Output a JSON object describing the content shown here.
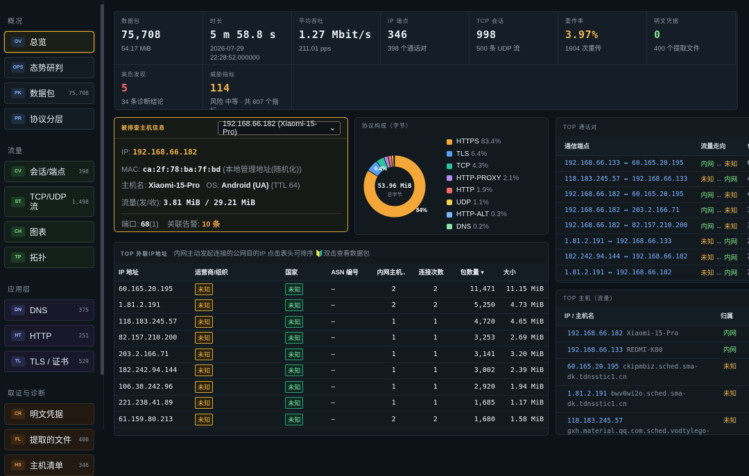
{
  "sidebar": {
    "sections": [
      {
        "title": "概况",
        "items": [
          {
            "badge": "OV",
            "label": "总览",
            "count": ""
          },
          {
            "badge": "OPS",
            "label": "态势研判",
            "count": ""
          },
          {
            "badge": "PK",
            "label": "数据包",
            "count": "75,708"
          },
          {
            "badge": "PR",
            "label": "协议分层",
            "count": ""
          }
        ]
      },
      {
        "title": "流量",
        "items": [
          {
            "badge": "CV",
            "label": "会话/端点",
            "count": "398"
          },
          {
            "badge": "ST",
            "label": "TCP/UDP 流",
            "count": "1,498"
          },
          {
            "badge": "CH",
            "label": "图表",
            "count": ""
          },
          {
            "badge": "TP",
            "label": "拓扑",
            "count": ""
          }
        ]
      },
      {
        "title": "应用层",
        "items": [
          {
            "badge": "DN",
            "label": "DNS",
            "count": "375"
          },
          {
            "badge": "HT",
            "label": "HTTP",
            "count": "251"
          },
          {
            "badge": "TL",
            "label": "TLS / 证书",
            "count": "529"
          }
        ]
      },
      {
        "title": "取证与诊断",
        "items": [
          {
            "badge": "CR",
            "label": "明文凭据",
            "count": ""
          },
          {
            "badge": "FL",
            "label": "提取的文件",
            "count": "400"
          },
          {
            "badge": "HS",
            "label": "主机清单",
            "count": "346"
          }
        ]
      }
    ]
  },
  "stats": [
    {
      "label": "数据包",
      "value": "75,708",
      "sub": "54.17 MiB",
      "color": "#e6edf3"
    },
    {
      "label": "时长",
      "value": "5 m 58.8 s",
      "sub": "2026-07-29 22:28:52.000000",
      "color": "#e6edf3"
    },
    {
      "label": "平均吞吐",
      "value": "1.27 Mbit/s",
      "sub": "211.01 pps",
      "color": "#e6edf3"
    },
    {
      "label": "IP 端点",
      "value": "346",
      "sub": "398 个通话对",
      "color": "#e6edf3"
    },
    {
      "label": "TCP 会话",
      "value": "998",
      "sub": "500 条 UDP 流",
      "color": "#e6edf3"
    },
    {
      "label": "重传率",
      "value": "3.97%",
      "sub": "1604 次重传",
      "color": "#f0b44c"
    },
    {
      "label": "明文凭据",
      "value": "0",
      "sub": "400 个提取文件",
      "color": "#7ee787"
    },
    {
      "label": "高危发现",
      "value": "5",
      "sub": "34 条诊断结论",
      "color": "#ff6b6b"
    },
    {
      "label": "威胁指标",
      "value": "114",
      "sub": "风险 中等 · 共 607 个指标",
      "color": "#f0b44c"
    }
  ],
  "host": {
    "title": "被排查主机信息",
    "selected": "192.168.66.182 (Xiaomi-15-Pro)",
    "ip_label": "IP:",
    "ip": "192.168.66.182",
    "mac_label": "MAC:",
    "mac": "ca:2f:78:ba:7f:bd",
    "mac_note": "(本地管理地址(随机化))",
    "hostname_label": "主机名:",
    "hostname": "Xiaomi-15-Pro",
    "os_label": "OS:",
    "os": "Android (UA)",
    "os_note": "(TTL 64)",
    "traffic_label": "流量(发/收):",
    "traffic": "3.81 MiB / 29.21 MiB",
    "ports_label": "端口:",
    "ports": "68",
    "ports_note": "(1)",
    "alerts_label": "关联告警:",
    "alerts": "10 条"
  },
  "protocol": {
    "title": "协议构成（字节）",
    "center_value": "53.96 MiB",
    "center_label": "总字节",
    "label_big": "84%",
    "label_small": "6.4%",
    "items": [
      {
        "name": "HTTPS",
        "pct": "83.4%",
        "value": 83.4,
        "color": "#f5a83a"
      },
      {
        "name": "TLS",
        "pct": "6.4%",
        "value": 6.4,
        "color": "#5aa0f2"
      },
      {
        "name": "TCP",
        "pct": "4.3%",
        "value": 4.3,
        "color": "#2ec4a0"
      },
      {
        "name": "HTTP-PROXY",
        "pct": "2.1%",
        "value": 2.1,
        "color": "#b58cf2"
      },
      {
        "name": "HTTP",
        "pct": "1.9%",
        "value": 1.9,
        "color": "#f26b6b"
      },
      {
        "name": "UDP",
        "pct": "1.1%",
        "value": 1.1,
        "color": "#f2d04a"
      },
      {
        "name": "HTTP-ALT",
        "pct": "0.3%",
        "value": 0.3,
        "color": "#7ab8f5"
      },
      {
        "name": "DNS",
        "pct": "0.2%",
        "value": 0.2,
        "color": "#8ee0b0"
      }
    ]
  },
  "conversations": {
    "title": "TOP 通话对",
    "headers": [
      "通信端点",
      "流量走向",
      "包"
    ],
    "rows": [
      {
        "ep": "192.168.66.133 ↔ 60.165.20.195",
        "from": "内网",
        "to": "未知",
        "n": "6,"
      },
      {
        "ep": "118.183.245.57 ↔ 192.168.66.133",
        "from": "未知",
        "to": "内网",
        "n": "4,"
      },
      {
        "ep": "192.168.66.182 ↔ 60.165.20.195",
        "from": "内网",
        "to": "未知",
        "n": "4,"
      },
      {
        "ep": "192.168.66.182 ↔ 203.2.166.71",
        "from": "内网",
        "to": "未知",
        "n": "3,"
      },
      {
        "ep": "192.168.66.182 ↔ 82.157.210.200",
        "from": "内网",
        "to": "未知",
        "n": "3,"
      },
      {
        "ep": "1.81.2.191 ↔ 192.168.66.133",
        "from": "未知",
        "to": "内网",
        "n": "2,"
      },
      {
        "ep": "182.242.94.144 ↔ 192.168.66.182",
        "from": "未知",
        "to": "内网",
        "n": "2,"
      },
      {
        "ep": "1.81.2.191 ↔ 192.168.66.182",
        "from": "未知",
        "to": "内网",
        "n": "2,"
      }
    ]
  },
  "hosts": {
    "title": "TOP 主机（流量）",
    "headers": [
      "IP / 主机名",
      "归属"
    ],
    "rows": [
      {
        "ip": "192.168.66.182",
        "name": "Xiaomi-15-Pro",
        "own": "内网"
      },
      {
        "ip": "192.168.66.133",
        "name": "REDMI-K80",
        "own": "内网"
      },
      {
        "ip": "60.165.20.195",
        "name": "ckipmbiz.sched.sma-dk.tdnsstic1.cn",
        "own": "未知"
      },
      {
        "ip": "1.81.2.191",
        "name": "bwv0wi2o.sched.sma-dk.tdnsstic1.cn",
        "own": "未知"
      },
      {
        "ip": "118.183.245.57",
        "name": "gxh.material.qq.com.sched.vodtylego-",
        "own": "未知"
      }
    ]
  },
  "external": {
    "title": "TOP 外联IP地址",
    "desc": "内网主动发起连接的公网目的IP 点击表头可排序 ",
    "hint": "双击查看数据包",
    "headers": [
      "IP 地址",
      "运营商/组织",
      "国家",
      "ASN 编号",
      "内网主机..",
      "连接次数",
      "包数量 ▾",
      "大小"
    ],
    "rows": [
      {
        "ip": "60.165.20.195",
        "org": "未知",
        "country": "未知",
        "asn": "–",
        "hosts": "2",
        "conns": "2",
        "pkts": "11,471",
        "size": "11.15 MiB"
      },
      {
        "ip": "1.81.2.191",
        "org": "未知",
        "country": "未知",
        "asn": "–",
        "hosts": "2",
        "conns": "2",
        "pkts": "5,250",
        "size": "4.73 MiB"
      },
      {
        "ip": "118.183.245.57",
        "org": "未知",
        "country": "未知",
        "asn": "–",
        "hosts": "1",
        "conns": "1",
        "pkts": "4,720",
        "size": "4.65 MiB"
      },
      {
        "ip": "82.157.210.200",
        "org": "未知",
        "country": "未知",
        "asn": "–",
        "hosts": "1",
        "conns": "1",
        "pkts": "3,253",
        "size": "2.69 MiB"
      },
      {
        "ip": "203.2.166.71",
        "org": "未知",
        "country": "未知",
        "asn": "–",
        "hosts": "1",
        "conns": "1",
        "pkts": "3,141",
        "size": "3.20 MiB"
      },
      {
        "ip": "182.242.94.144",
        "org": "未知",
        "country": "未知",
        "asn": "–",
        "hosts": "1",
        "conns": "1",
        "pkts": "3,002",
        "size": "2.39 MiB"
      },
      {
        "ip": "106.38.242.96",
        "org": "未知",
        "country": "未知",
        "asn": "–",
        "hosts": "1",
        "conns": "1",
        "pkts": "2,920",
        "size": "1.94 MiB"
      },
      {
        "ip": "221.238.41.89",
        "org": "未知",
        "country": "未知",
        "asn": "–",
        "hosts": "1",
        "conns": "1",
        "pkts": "1,685",
        "size": "1.17 MiB"
      },
      {
        "ip": "61.159.80.213",
        "org": "未知",
        "country": "未知",
        "asn": "–",
        "hosts": "2",
        "conns": "2",
        "pkts": "1,680",
        "size": "1.58 MiB"
      }
    ]
  }
}
